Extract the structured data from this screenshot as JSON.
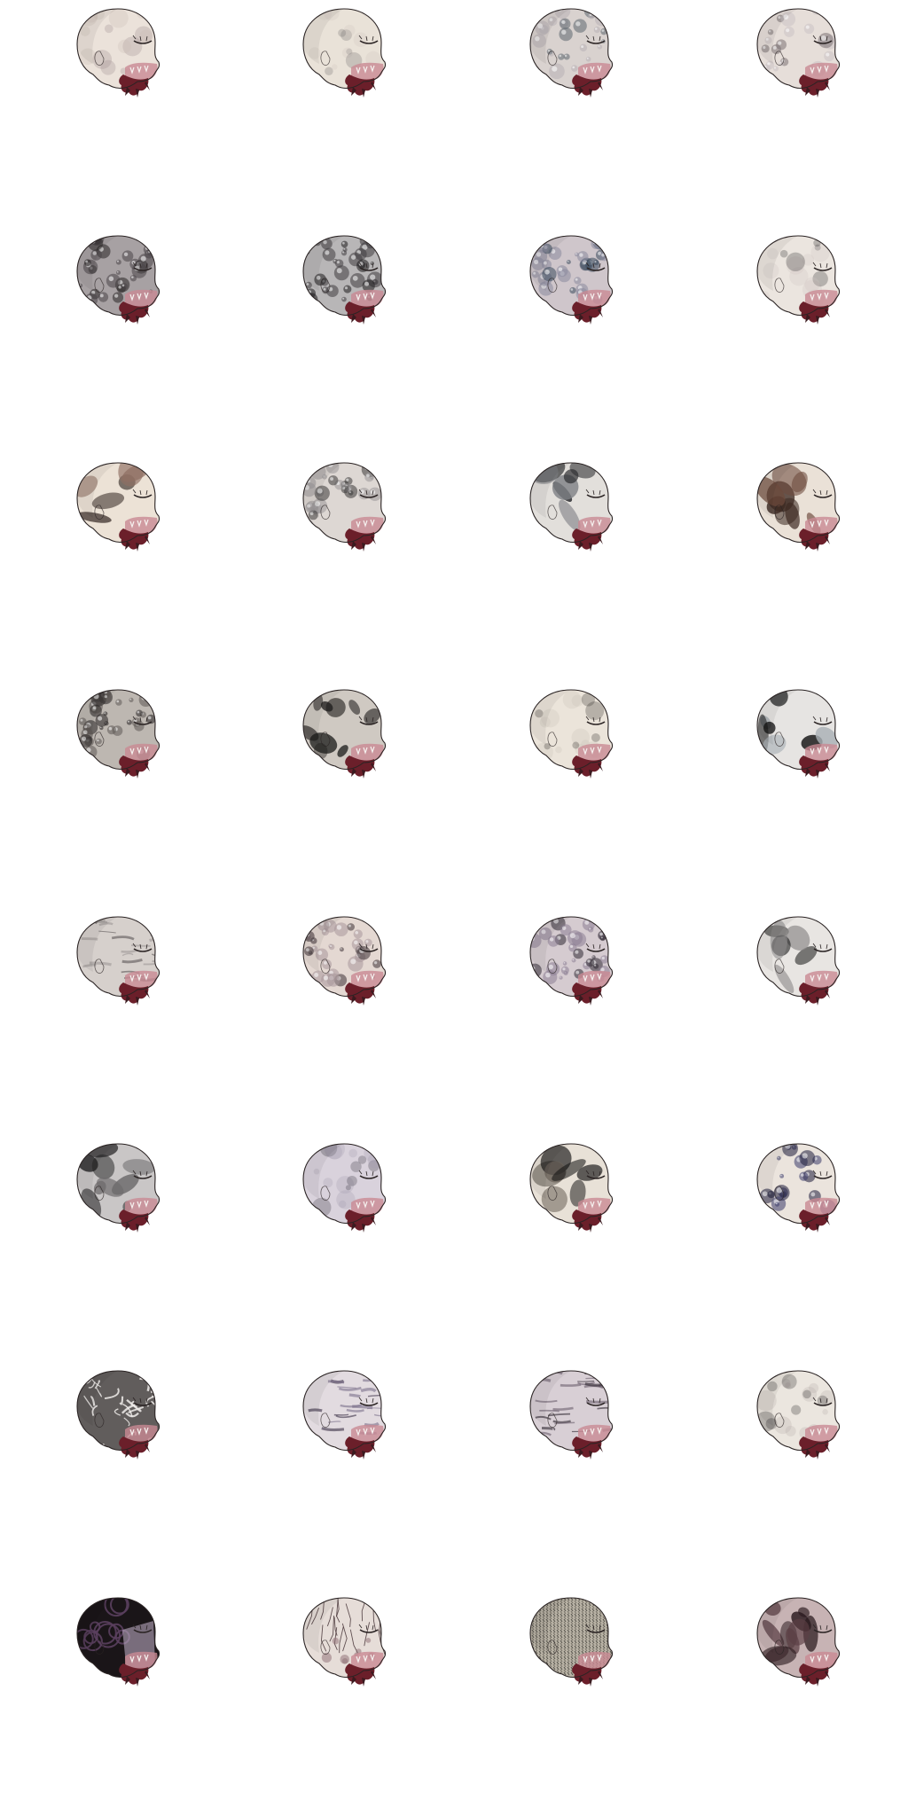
{
  "sheet": {
    "rows": 8,
    "cols": 4,
    "sprites": [
      {
        "name": "head-sprite-r1c1",
        "skin": "#ebe2da",
        "texture": "light-mottle",
        "shade": "#c9b9b5",
        "mark": "#9a8a8c",
        "density": 0.25
      },
      {
        "name": "head-sprite-r1c2",
        "skin": "#e9e2d8",
        "texture": "light-mottle",
        "shade": "#cfc6bd",
        "mark": "#6f6d6a",
        "density": 0.2
      },
      {
        "name": "head-sprite-r1c3",
        "skin": "#d9d2cf",
        "texture": "bubbles",
        "shade": "#b8b1b6",
        "mark": "#5d6670",
        "density": 0.6
      },
      {
        "name": "head-sprite-r1c4",
        "skin": "#e6ded9",
        "texture": "bubbles",
        "shade": "#cbc2c4",
        "mark": "#7c7275",
        "density": 0.4
      },
      {
        "name": "head-sprite-r2c1",
        "skin": "#a7a1a3",
        "texture": "bubbles",
        "shade": "#4b4648",
        "mark": "#2a2627",
        "density": 0.8
      },
      {
        "name": "head-sprite-r2c2",
        "skin": "#b8b6b7",
        "texture": "bubbles",
        "shade": "#3f3d3f",
        "mark": "#1d1c1d",
        "density": 0.8
      },
      {
        "name": "head-sprite-r2c3",
        "skin": "#cfc6cb",
        "texture": "bubbles",
        "shade": "#8b8a9e",
        "mark": "#3b4a5c",
        "density": 0.7
      },
      {
        "name": "head-sprite-r2c4",
        "skin": "#ebe5df",
        "texture": "light-mottle",
        "shade": "#cfc7c3",
        "mark": "#2b2a2c",
        "density": 0.25
      },
      {
        "name": "head-sprite-r3c1",
        "skin": "#ece2d6",
        "texture": "splotch",
        "shade": "#8f6f63",
        "mark": "#3a2e2a",
        "density": 0.3
      },
      {
        "name": "head-sprite-r3c2",
        "skin": "#ddd7d3",
        "texture": "bubbles",
        "shade": "#9a9799",
        "mark": "#3a3839",
        "density": 0.6
      },
      {
        "name": "head-sprite-r3c3",
        "skin": "#e2dfdb",
        "texture": "splotch",
        "shade": "#7e8085",
        "mark": "#2a2b2e",
        "density": 0.45
      },
      {
        "name": "head-sprite-r3c4",
        "skin": "#eae1d7",
        "texture": "splotch",
        "shade": "#6d4a3c",
        "mark": "#3d2a22",
        "density": 0.5
      },
      {
        "name": "head-sprite-r4c1",
        "skin": "#bdb7b1",
        "texture": "bubbles",
        "shade": "#5e5955",
        "mark": "#262322",
        "density": 0.85
      },
      {
        "name": "head-sprite-r4c2",
        "skin": "#cfc9c2",
        "texture": "splotch",
        "shade": "#3f3c39",
        "mark": "#1b1a19",
        "density": 0.6
      },
      {
        "name": "head-sprite-r4c3",
        "skin": "#ebe4da",
        "texture": "light-mottle",
        "shade": "#c9c2b8",
        "mark": "#2d2b29",
        "density": 0.3
      },
      {
        "name": "head-sprite-r4c4",
        "skin": "#e6e4e2",
        "texture": "splotch",
        "shade": "#a9b0b5",
        "mark": "#141414",
        "density": 0.4
      },
      {
        "name": "head-sprite-r5c1",
        "skin": "#d6d0cc",
        "texture": "streaks",
        "shade": "#9d9796",
        "mark": "#5b5657",
        "density": 0.5
      },
      {
        "name": "head-sprite-r5c2",
        "skin": "#e4d8d2",
        "texture": "bubbles",
        "shade": "#a7979a",
        "mark": "#3c3234",
        "density": 0.75
      },
      {
        "name": "head-sprite-r5c3",
        "skin": "#d5cbd0",
        "texture": "bubbles",
        "shade": "#8d7f93",
        "mark": "#2f2a33",
        "density": 0.8
      },
      {
        "name": "head-sprite-r5c4",
        "skin": "#e8e5e2",
        "texture": "splotch",
        "shade": "#8e8c8c",
        "mark": "#0f0f10",
        "density": 0.35
      },
      {
        "name": "head-sprite-r6c1",
        "skin": "#c9c6c6",
        "texture": "splotch",
        "shade": "#6d6b6c",
        "mark": "#232223",
        "density": 0.6
      },
      {
        "name": "head-sprite-r6c2",
        "skin": "#d9d2dc",
        "texture": "light-mottle",
        "shade": "#a59eb0",
        "mark": "#3b3742",
        "density": 0.35
      },
      {
        "name": "head-sprite-r6c3",
        "skin": "#e8e1d7",
        "texture": "splotch",
        "shade": "#6b625a",
        "mark": "#111111",
        "density": 0.4
      },
      {
        "name": "head-sprite-r6c4",
        "skin": "#ebe4dd",
        "texture": "bubbles",
        "shade": "#3b3a6a",
        "mark": "#1d1c3a",
        "density": 0.35
      },
      {
        "name": "head-sprite-r7c1",
        "skin": "#9f9a98",
        "texture": "web",
        "shade": "#2e2b2b",
        "mark": "#f0ecea",
        "density": 0.9
      },
      {
        "name": "head-sprite-r7c2",
        "skin": "#e2dbe0",
        "texture": "streaks",
        "shade": "#7b6f8a",
        "mark": "#3a2f45",
        "density": 0.45
      },
      {
        "name": "head-sprite-r7c3",
        "skin": "#d8cfd5",
        "texture": "streaks",
        "shade": "#6d5f6e",
        "mark": "#2e2630",
        "density": 0.55
      },
      {
        "name": "head-sprite-r7c4",
        "skin": "#ebe6df",
        "texture": "light-mottle",
        "shade": "#b7aeaa",
        "mark": "#2a2627",
        "density": 0.35
      },
      {
        "name": "head-sprite-r8c1",
        "skin": "#1a1518",
        "texture": "dark",
        "shade": "#5a3f5e",
        "mark": "#b9a8c0",
        "density": 0.9
      },
      {
        "name": "head-sprite-r8c2",
        "skin": "#e6ddd8",
        "texture": "cracks",
        "shade": "#8c6b72",
        "mark": "#3d2a2e",
        "density": 0.5
      },
      {
        "name": "head-sprite-r8c3",
        "skin": "#b9b3a6",
        "texture": "fur",
        "shade": "#5a554c",
        "mark": "#2a2824",
        "density": 0.9
      },
      {
        "name": "head-sprite-r8c4",
        "skin": "#c7b3b4",
        "texture": "splotch",
        "shade": "#5b3f44",
        "mark": "#2a1a1e",
        "density": 0.7
      }
    ]
  },
  "colors": {
    "background": "#ffffff",
    "outline": "#2b2424",
    "blood": "#6b1f2a",
    "blood_light": "#c98a94",
    "jaw": "#3a1a1f"
  }
}
